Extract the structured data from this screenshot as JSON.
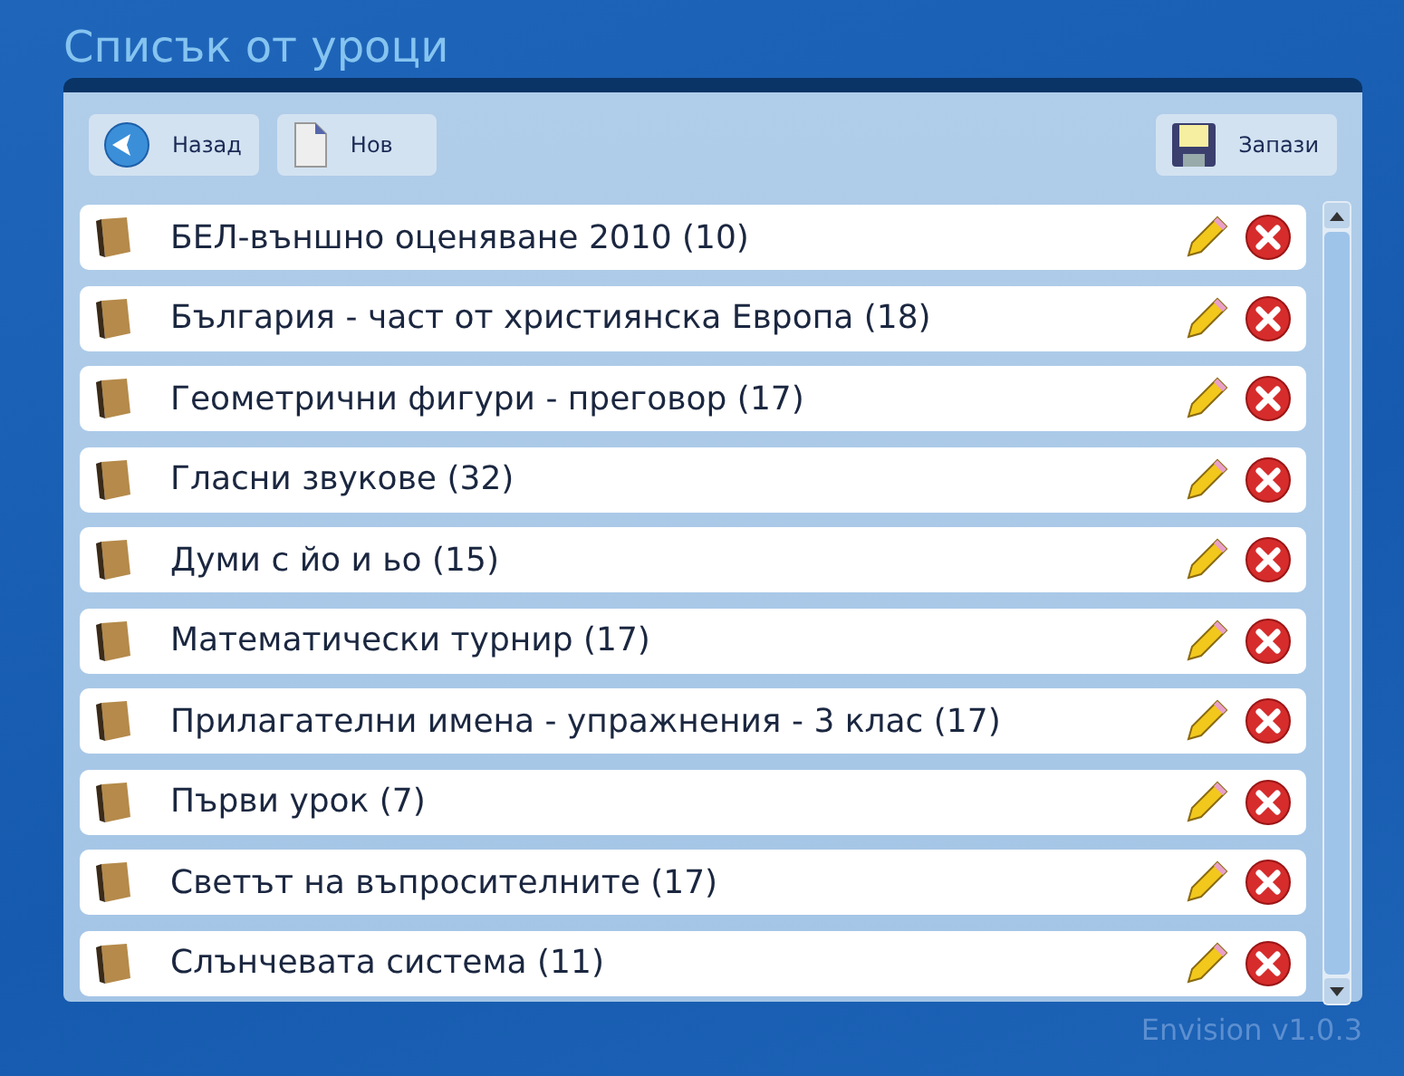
{
  "title": "Списък от уроци",
  "toolbar": {
    "left": [
      {
        "label": "Назад",
        "kind": "back"
      },
      {
        "label": "Нов",
        "kind": "new"
      }
    ],
    "right": [
      {
        "label": "Запази",
        "kind": "save"
      }
    ]
  },
  "lessons": [
    {
      "label": "БЕЛ-външно оценяване 2010 (10)"
    },
    {
      "label": "България - част от християнска Европа (18)"
    },
    {
      "label": "Геометрични фигури - преговор (17)"
    },
    {
      "label": "Гласни звукове (32)"
    },
    {
      "label": "Думи с йо и ьо (15)"
    },
    {
      "label": "Математически турнир (17)"
    },
    {
      "label": "Прилагателни имена - упражнения - 3 клас (17)"
    },
    {
      "label": "Първи урок (7)"
    },
    {
      "label": "Светът на въпросителните (17)"
    },
    {
      "label": "Слънчевата система (11)"
    }
  ],
  "version": "Envision v1.0.3"
}
